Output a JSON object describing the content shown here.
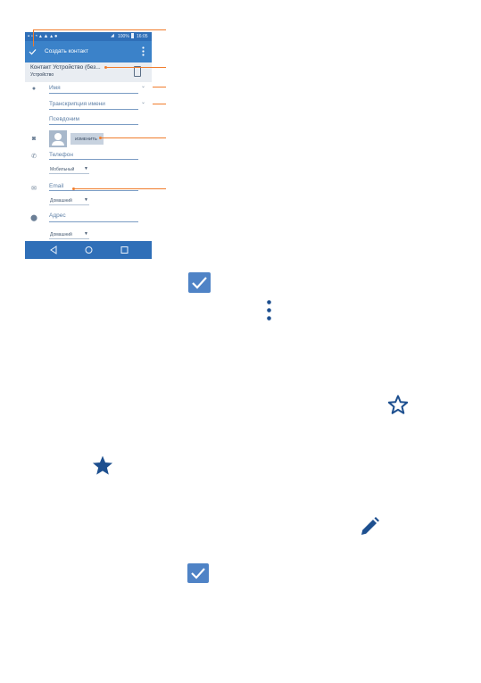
{
  "status_bar": {
    "battery": "100%",
    "time": "16:05"
  },
  "app_bar": {
    "title": "Создать контакт"
  },
  "account": {
    "name": "Контакт Устройство (без...",
    "type": "Устройство"
  },
  "fields": {
    "name": "Имя",
    "phonetic": "Транскрипция имени",
    "nickname": "Псевдоним",
    "change_photo": "ИЗМЕНИТЬ",
    "phone": "Телефон",
    "phone_type": "Мобильный",
    "email": "Email",
    "email_type": "Домашний",
    "address": "Адрес",
    "address_type": "Домашний"
  },
  "colors": {
    "primary": "#3b82c9",
    "primary_dark": "#2f6fb8",
    "callout": "#f07c2c",
    "icon_blue": "#1d4f8f"
  },
  "icons": [
    "check-icon",
    "more-vert-icon",
    "star-outline-icon",
    "star-filled-icon",
    "pencil-icon"
  ]
}
